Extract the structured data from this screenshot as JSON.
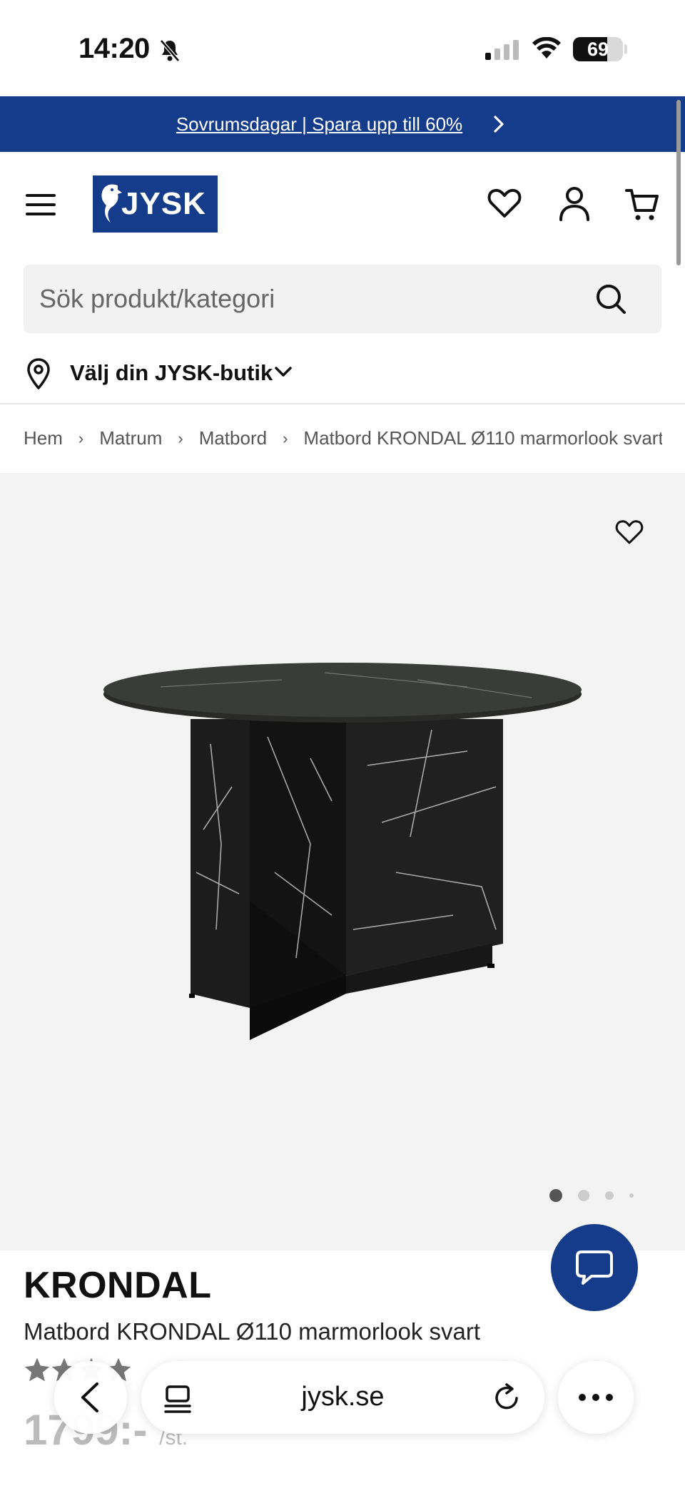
{
  "status_bar": {
    "time": "14:20",
    "battery_level": "69",
    "battery_fraction": 0.69
  },
  "promo": {
    "text": "Sovrumsdagar | Spara upp till 60%",
    "color": "#143c8a"
  },
  "header": {
    "logo_text": "JYSK",
    "icons": [
      "menu-icon",
      "heart-icon",
      "user-icon",
      "cart-icon"
    ]
  },
  "search": {
    "placeholder": "Sök produkt/kategori",
    "value": ""
  },
  "store": {
    "label": "Välj din JYSK-butik"
  },
  "breadcrumb": [
    "Hem",
    "Matrum",
    "Matbord",
    "Matbord KRONDAL Ø110 marmorlook svart"
  ],
  "gallery": {
    "image_count": 4,
    "active_index": 0
  },
  "product": {
    "brand": "KRONDAL",
    "name": "Matbord KRONDAL Ø110 marmorlook svart",
    "price": "1799:-",
    "price_unit": "/st."
  },
  "browser": {
    "url": "jysk.se"
  },
  "colors": {
    "brand_blue": "#143c8a",
    "gallery_bg": "#f3f3f3"
  }
}
